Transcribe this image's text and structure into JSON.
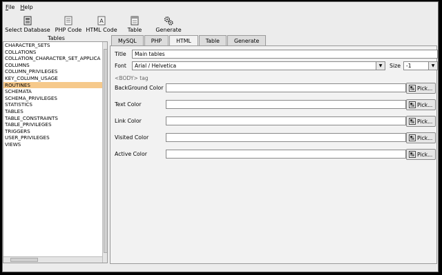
{
  "menu": [
    {
      "label": "File",
      "mnemonic": "F",
      "rest": "ile"
    },
    {
      "label": "Help",
      "mnemonic": "H",
      "rest": "elp"
    }
  ],
  "toolbar": [
    {
      "label": "Select Database",
      "icon": "database-icon"
    },
    {
      "label": "PHP Code",
      "icon": "php-code-icon"
    },
    {
      "label": "HTML Code",
      "icon": "html-code-icon"
    },
    {
      "label": "Table",
      "icon": "table-icon"
    },
    {
      "label": "Generate",
      "icon": "generate-gears-icon"
    }
  ],
  "tables_label": "Tables",
  "tables": [
    "CHARACTER_SETS",
    "COLLATIONS",
    "COLLATION_CHARACTER_SET_APPLICA",
    "COLUMNS",
    "COLUMN_PRIVILEGES",
    "KEY_COLUMN_USAGE",
    "ROUTINES",
    "SCHEMATA",
    "SCHEMA_PRIVILEGES",
    "STATISTICS",
    "TABLES",
    "TABLE_CONSTRAINTS",
    "TABLE_PRIVILEGES",
    "TRIGGERS",
    "USER_PRIVILEGES",
    "VIEWS"
  ],
  "selected_table": "ROUTINES",
  "tabs": [
    "MySQL",
    "PHP",
    "HTML",
    "Table",
    "Generate"
  ],
  "active_tab": "HTML",
  "form": {
    "title_label": "Title",
    "title_value": "Main tables",
    "font_label": "Font",
    "font_value": "Arial / Helvetica",
    "size_label": "Size",
    "size_value": "-1",
    "body_section": "<BODY> tag",
    "colors": [
      {
        "label": "BackGround Color",
        "value": ""
      },
      {
        "label": "Text Color",
        "value": ""
      },
      {
        "label": "Link Color",
        "value": ""
      },
      {
        "label": "Visited Color",
        "value": ""
      },
      {
        "label": "Active Color",
        "value": ""
      }
    ],
    "pick_label": "Pick..."
  },
  "colors": {
    "selection": "#f6c98b",
    "window_bg": "#ececec"
  }
}
